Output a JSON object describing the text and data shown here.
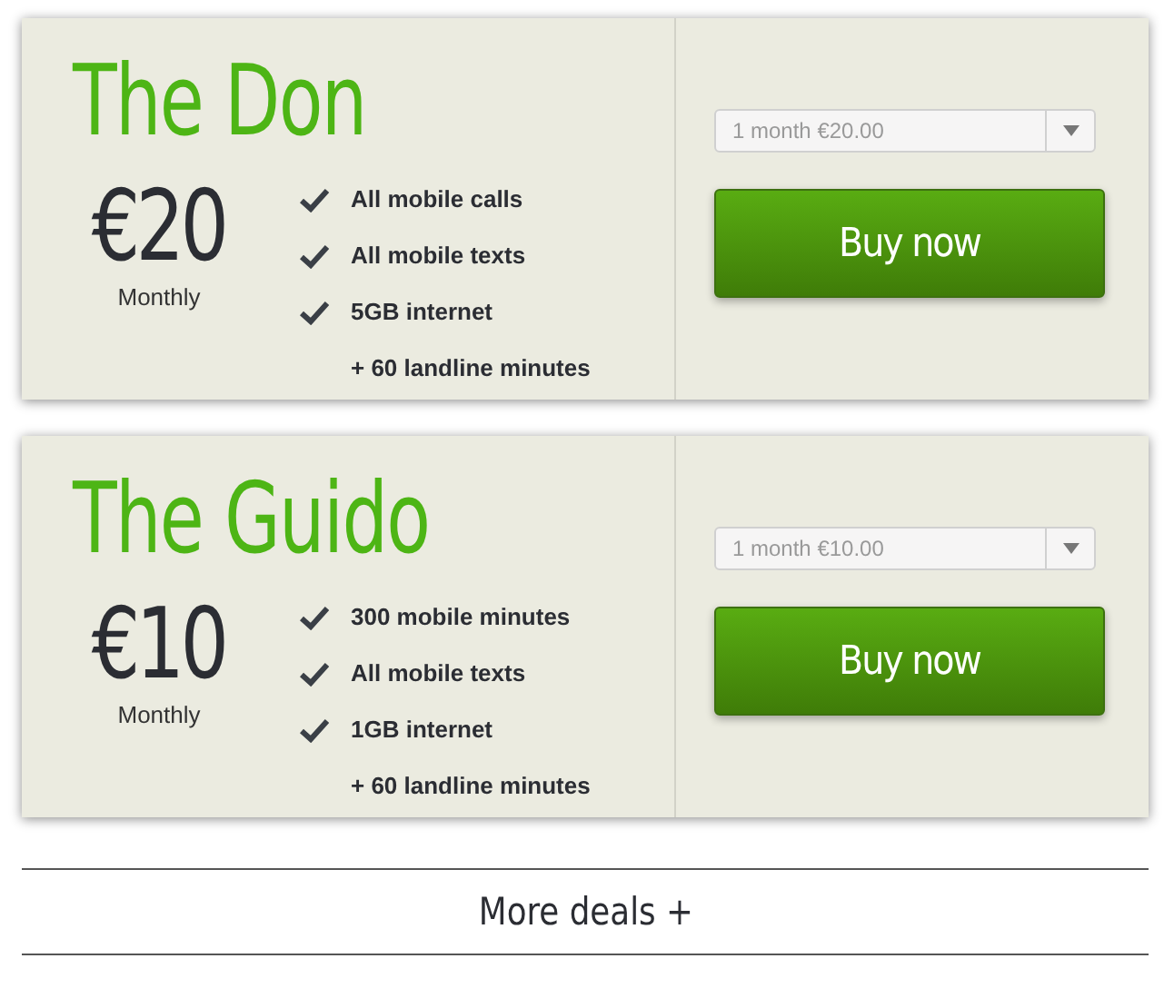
{
  "plans": [
    {
      "name": "The Don",
      "price": "€20",
      "period": "Monthly",
      "features": [
        {
          "text": "All mobile calls",
          "checked": true
        },
        {
          "text": "All mobile texts",
          "checked": true
        },
        {
          "text": "5GB internet",
          "checked": true
        },
        {
          "text": "+ 60 landline minutes",
          "checked": false
        }
      ],
      "select": {
        "value": "1 month €20.00"
      },
      "button": "Buy now"
    },
    {
      "name": "The Guido",
      "price": "€10",
      "period": "Monthly",
      "features": [
        {
          "text": "300 mobile minutes",
          "checked": true
        },
        {
          "text": "All mobile texts",
          "checked": true
        },
        {
          "text": "1GB internet",
          "checked": true
        },
        {
          "text": "+ 60 landline minutes",
          "checked": false
        }
      ],
      "select": {
        "value": "1 month €10.00"
      },
      "button": "Buy now"
    }
  ],
  "more_deals": "More deals +"
}
